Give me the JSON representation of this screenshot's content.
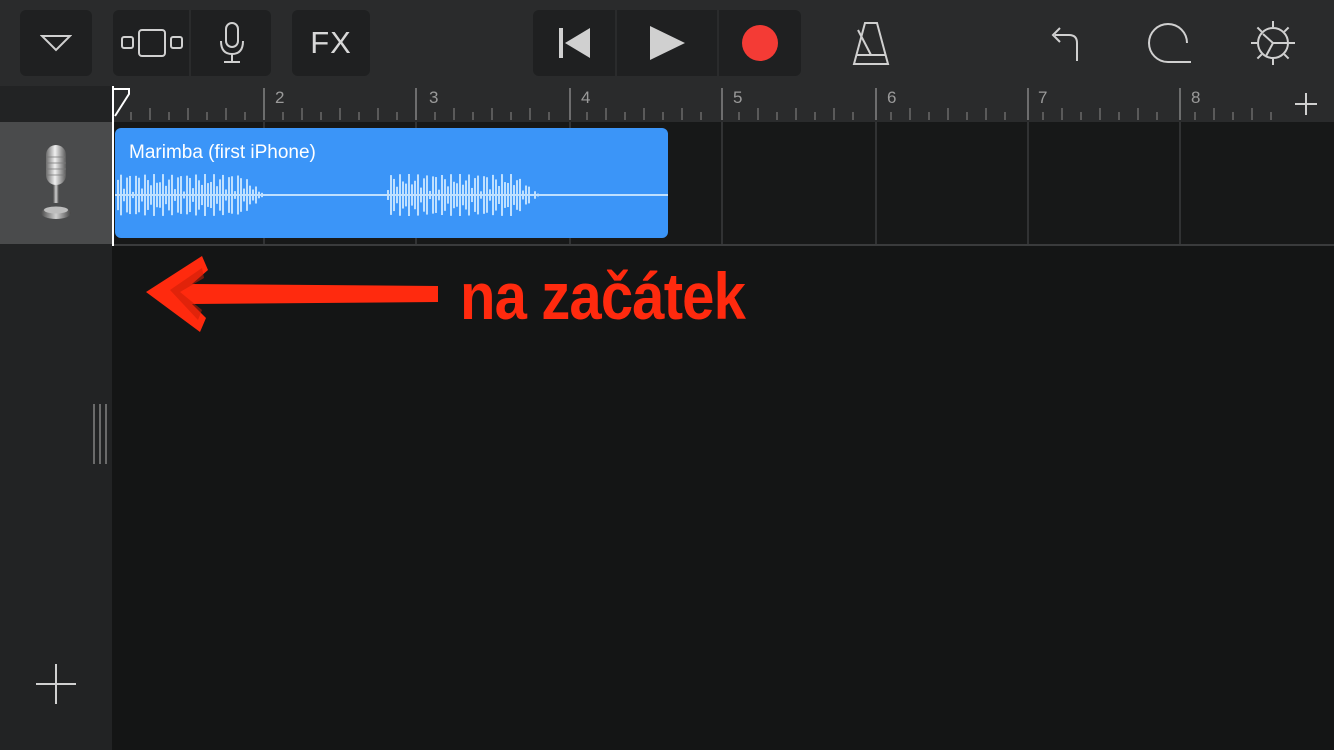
{
  "toolbar": {
    "fx_label": "FX",
    "colors": {
      "record": "#f43b35",
      "region": "#3b95f8",
      "annotation": "#ff2a0e"
    }
  },
  "ruler": {
    "bars": [
      "2",
      "3",
      "4",
      "5",
      "6",
      "7",
      "8"
    ]
  },
  "tracks": [
    {
      "instrument": "microphone-icon",
      "region_name": "Marimba (first iPhone)"
    }
  ],
  "annotation": {
    "text": "na začátek"
  }
}
